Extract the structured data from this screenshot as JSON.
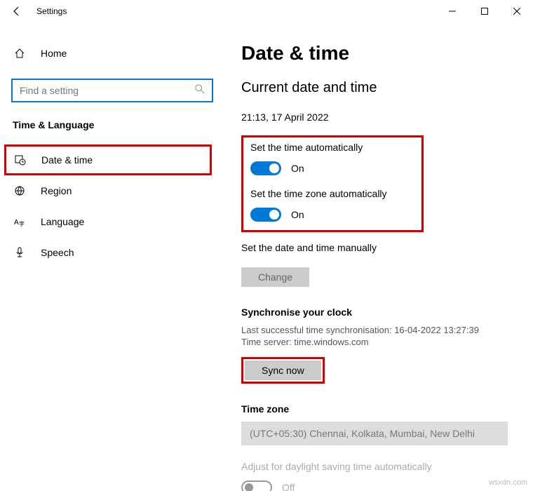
{
  "titlebar": {
    "title": "Settings"
  },
  "sidebar": {
    "home": "Home",
    "search_placeholder": "Find a setting",
    "section": "Time & Language",
    "items": [
      {
        "label": "Date & time"
      },
      {
        "label": "Region"
      },
      {
        "label": "Language"
      },
      {
        "label": "Speech"
      }
    ]
  },
  "main": {
    "title": "Date & time",
    "subtitle": "Current date and time",
    "datetime": "21:13, 17 April 2022",
    "auto_time": {
      "label": "Set the time automatically",
      "state": "On"
    },
    "auto_zone": {
      "label": "Set the time zone automatically",
      "state": "On"
    },
    "manual": {
      "label": "Set the date and time manually",
      "button": "Change"
    },
    "sync": {
      "head": "Synchronise your clock",
      "last": "Last successful time synchronisation: 16-04-2022 13:27:39",
      "server": "Time server: time.windows.com",
      "button": "Sync now"
    },
    "tz": {
      "head": "Time zone",
      "value": "(UTC+05:30) Chennai, Kolkata, Mumbai, New Delhi"
    },
    "dst": {
      "label": "Adjust for daylight saving time automatically",
      "state": "Off"
    }
  },
  "watermark": "wsxdn.com"
}
